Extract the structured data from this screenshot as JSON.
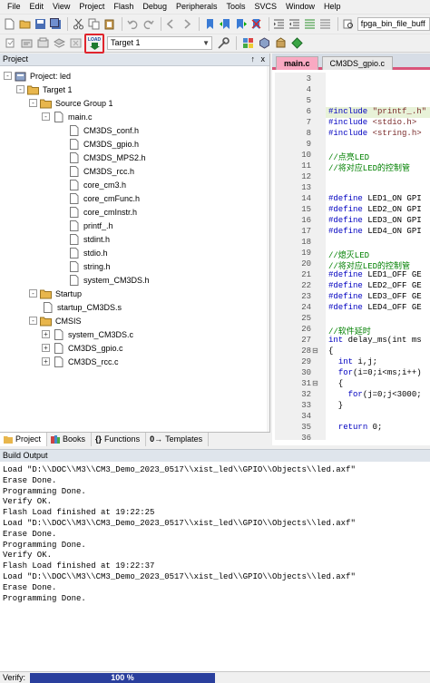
{
  "menu": [
    "File",
    "Edit",
    "View",
    "Project",
    "Flash",
    "Debug",
    "Peripherals",
    "Tools",
    "SVCS",
    "Window",
    "Help"
  ],
  "toolbar": {
    "target_combo": "Target 1",
    "search_combo": "fpga_bin_file_buff",
    "load_button_label": "LOAD"
  },
  "project_panel": {
    "title": "Project",
    "pin": "↑",
    "close": "x",
    "tree": [
      {
        "label": "Project: led",
        "level": 0,
        "type": "project",
        "exp": "-"
      },
      {
        "label": "Target 1",
        "level": 1,
        "type": "target",
        "exp": "-"
      },
      {
        "label": "Source Group 1",
        "level": 2,
        "type": "folder",
        "exp": "-"
      },
      {
        "label": "main.c",
        "level": 3,
        "type": "cfile",
        "exp": "-"
      },
      {
        "label": "CM3DS_conf.h",
        "level": 4,
        "type": "hfile"
      },
      {
        "label": "CM3DS_gpio.h",
        "level": 4,
        "type": "hfile"
      },
      {
        "label": "CM3DS_MPS2.h",
        "level": 4,
        "type": "hfile"
      },
      {
        "label": "CM3DS_rcc.h",
        "level": 4,
        "type": "hfile"
      },
      {
        "label": "core_cm3.h",
        "level": 4,
        "type": "hfile"
      },
      {
        "label": "core_cmFunc.h",
        "level": 4,
        "type": "hfile"
      },
      {
        "label": "core_cmInstr.h",
        "level": 4,
        "type": "hfile"
      },
      {
        "label": "printf_.h",
        "level": 4,
        "type": "hfile"
      },
      {
        "label": "stdint.h",
        "level": 4,
        "type": "hfile"
      },
      {
        "label": "stdio.h",
        "level": 4,
        "type": "hfile"
      },
      {
        "label": "string.h",
        "level": 4,
        "type": "hfile"
      },
      {
        "label": "system_CM3DS.h",
        "level": 4,
        "type": "hfile"
      },
      {
        "label": "Startup",
        "level": 2,
        "type": "folder",
        "exp": "-"
      },
      {
        "label": "startup_CM3DS.s",
        "level": 3,
        "type": "sfile"
      },
      {
        "label": "CMSIS",
        "level": 2,
        "type": "folder",
        "exp": "-"
      },
      {
        "label": "system_CM3DS.c",
        "level": 3,
        "type": "cfile",
        "exp": "+"
      },
      {
        "label": "CM3DS_gpio.c",
        "level": 3,
        "type": "cfile",
        "exp": "+"
      },
      {
        "label": "CM3DS_rcc.c",
        "level": 3,
        "type": "cfile",
        "exp": "+"
      }
    ],
    "tabs": [
      "Project",
      "Books",
      "Functions",
      "Templates"
    ],
    "tab_prefixes": [
      "",
      "",
      "{}",
      "0→"
    ]
  },
  "editor": {
    "tabs": [
      "main.c",
      "CM3DS_gpio.c"
    ],
    "lines": [
      {
        "n": "3",
        "fold": "",
        "code": ""
      },
      {
        "n": "4",
        "fold": "",
        "code": ""
      },
      {
        "n": "5",
        "fold": "",
        "code": ""
      },
      {
        "n": "6",
        "fold": "",
        "code": "#include \"printf_.h\"",
        "hl": true
      },
      {
        "n": "7",
        "fold": "",
        "code": "#include <stdio.h>"
      },
      {
        "n": "8",
        "fold": "",
        "code": "#include <string.h>"
      },
      {
        "n": "9",
        "fold": "",
        "code": ""
      },
      {
        "n": "10",
        "fold": "",
        "code": "//点亮LED",
        "comment": true
      },
      {
        "n": "11",
        "fold": "",
        "code": "//将对应LED的控制管",
        "comment": true
      },
      {
        "n": "12",
        "fold": "",
        "code": ""
      },
      {
        "n": "13",
        "fold": "",
        "code": ""
      },
      {
        "n": "14",
        "fold": "",
        "code": "#define LED1_ON GPI"
      },
      {
        "n": "15",
        "fold": "",
        "code": "#define LED2_ON GPI"
      },
      {
        "n": "16",
        "fold": "",
        "code": "#define LED3_ON GPI"
      },
      {
        "n": "17",
        "fold": "",
        "code": "#define LED4_ON GPI"
      },
      {
        "n": "18",
        "fold": "",
        "code": ""
      },
      {
        "n": "19",
        "fold": "",
        "code": "//熄灭LED",
        "comment": true
      },
      {
        "n": "20",
        "fold": "",
        "code": "//将对应LED的控制管",
        "comment": true
      },
      {
        "n": "21",
        "fold": "",
        "code": "#define LED1_OFF GE"
      },
      {
        "n": "22",
        "fold": "",
        "code": "#define LED2_OFF GE"
      },
      {
        "n": "23",
        "fold": "",
        "code": "#define LED3_OFF GE"
      },
      {
        "n": "24",
        "fold": "",
        "code": "#define LED4_OFF GE"
      },
      {
        "n": "25",
        "fold": "",
        "code": ""
      },
      {
        "n": "26",
        "fold": "",
        "code": "//软件延时",
        "comment": true
      },
      {
        "n": "27",
        "fold": "",
        "code": "int delay_ms(int ms"
      },
      {
        "n": "28",
        "fold": "⊟",
        "code": "{"
      },
      {
        "n": "29",
        "fold": "",
        "code": "  int i,j;"
      },
      {
        "n": "30",
        "fold": "",
        "code": "  for(i=0;i<ms;i++)"
      },
      {
        "n": "31",
        "fold": "⊟",
        "code": "  {"
      },
      {
        "n": "32",
        "fold": "",
        "code": "    for(j=0;j<3000;"
      },
      {
        "n": "33",
        "fold": "",
        "code": "  }"
      },
      {
        "n": "34",
        "fold": "",
        "code": ""
      },
      {
        "n": "35",
        "fold": "",
        "code": "  return 0;"
      },
      {
        "n": "36",
        "fold": "",
        "code": ""
      }
    ]
  },
  "build_output": {
    "title": "Build Output",
    "lines": [
      "Load \"D:\\\\DOC\\\\M3\\\\CM3_Demo_2023_0517\\\\xist_led\\\\GPIO\\\\Objects\\\\led.axf\"",
      "Erase Done.",
      "Programming Done.",
      "Verify OK.",
      "Flash Load finished at 19:22:25",
      "Load \"D:\\\\DOC\\\\M3\\\\CM3_Demo_2023_0517\\\\xist_led\\\\GPIO\\\\Objects\\\\led.axf\"",
      "Erase Done.",
      "Programming Done.",
      "Verify OK.",
      "Flash Load finished at 19:22:37",
      "Load \"D:\\\\DOC\\\\M3\\\\CM3_Demo_2023_0517\\\\xist_led\\\\GPIO\\\\Objects\\\\led.axf\"",
      "Erase Done.",
      "Programming Done."
    ]
  },
  "status": {
    "label": "Verify:",
    "progress_text": "100 %",
    "progress": 1.0
  },
  "colors": {
    "highlight_box": "#e0242c",
    "progress_bar": "#2a3f9d",
    "active_tab": "#f9a9c2",
    "folder": "#e8b64c"
  }
}
